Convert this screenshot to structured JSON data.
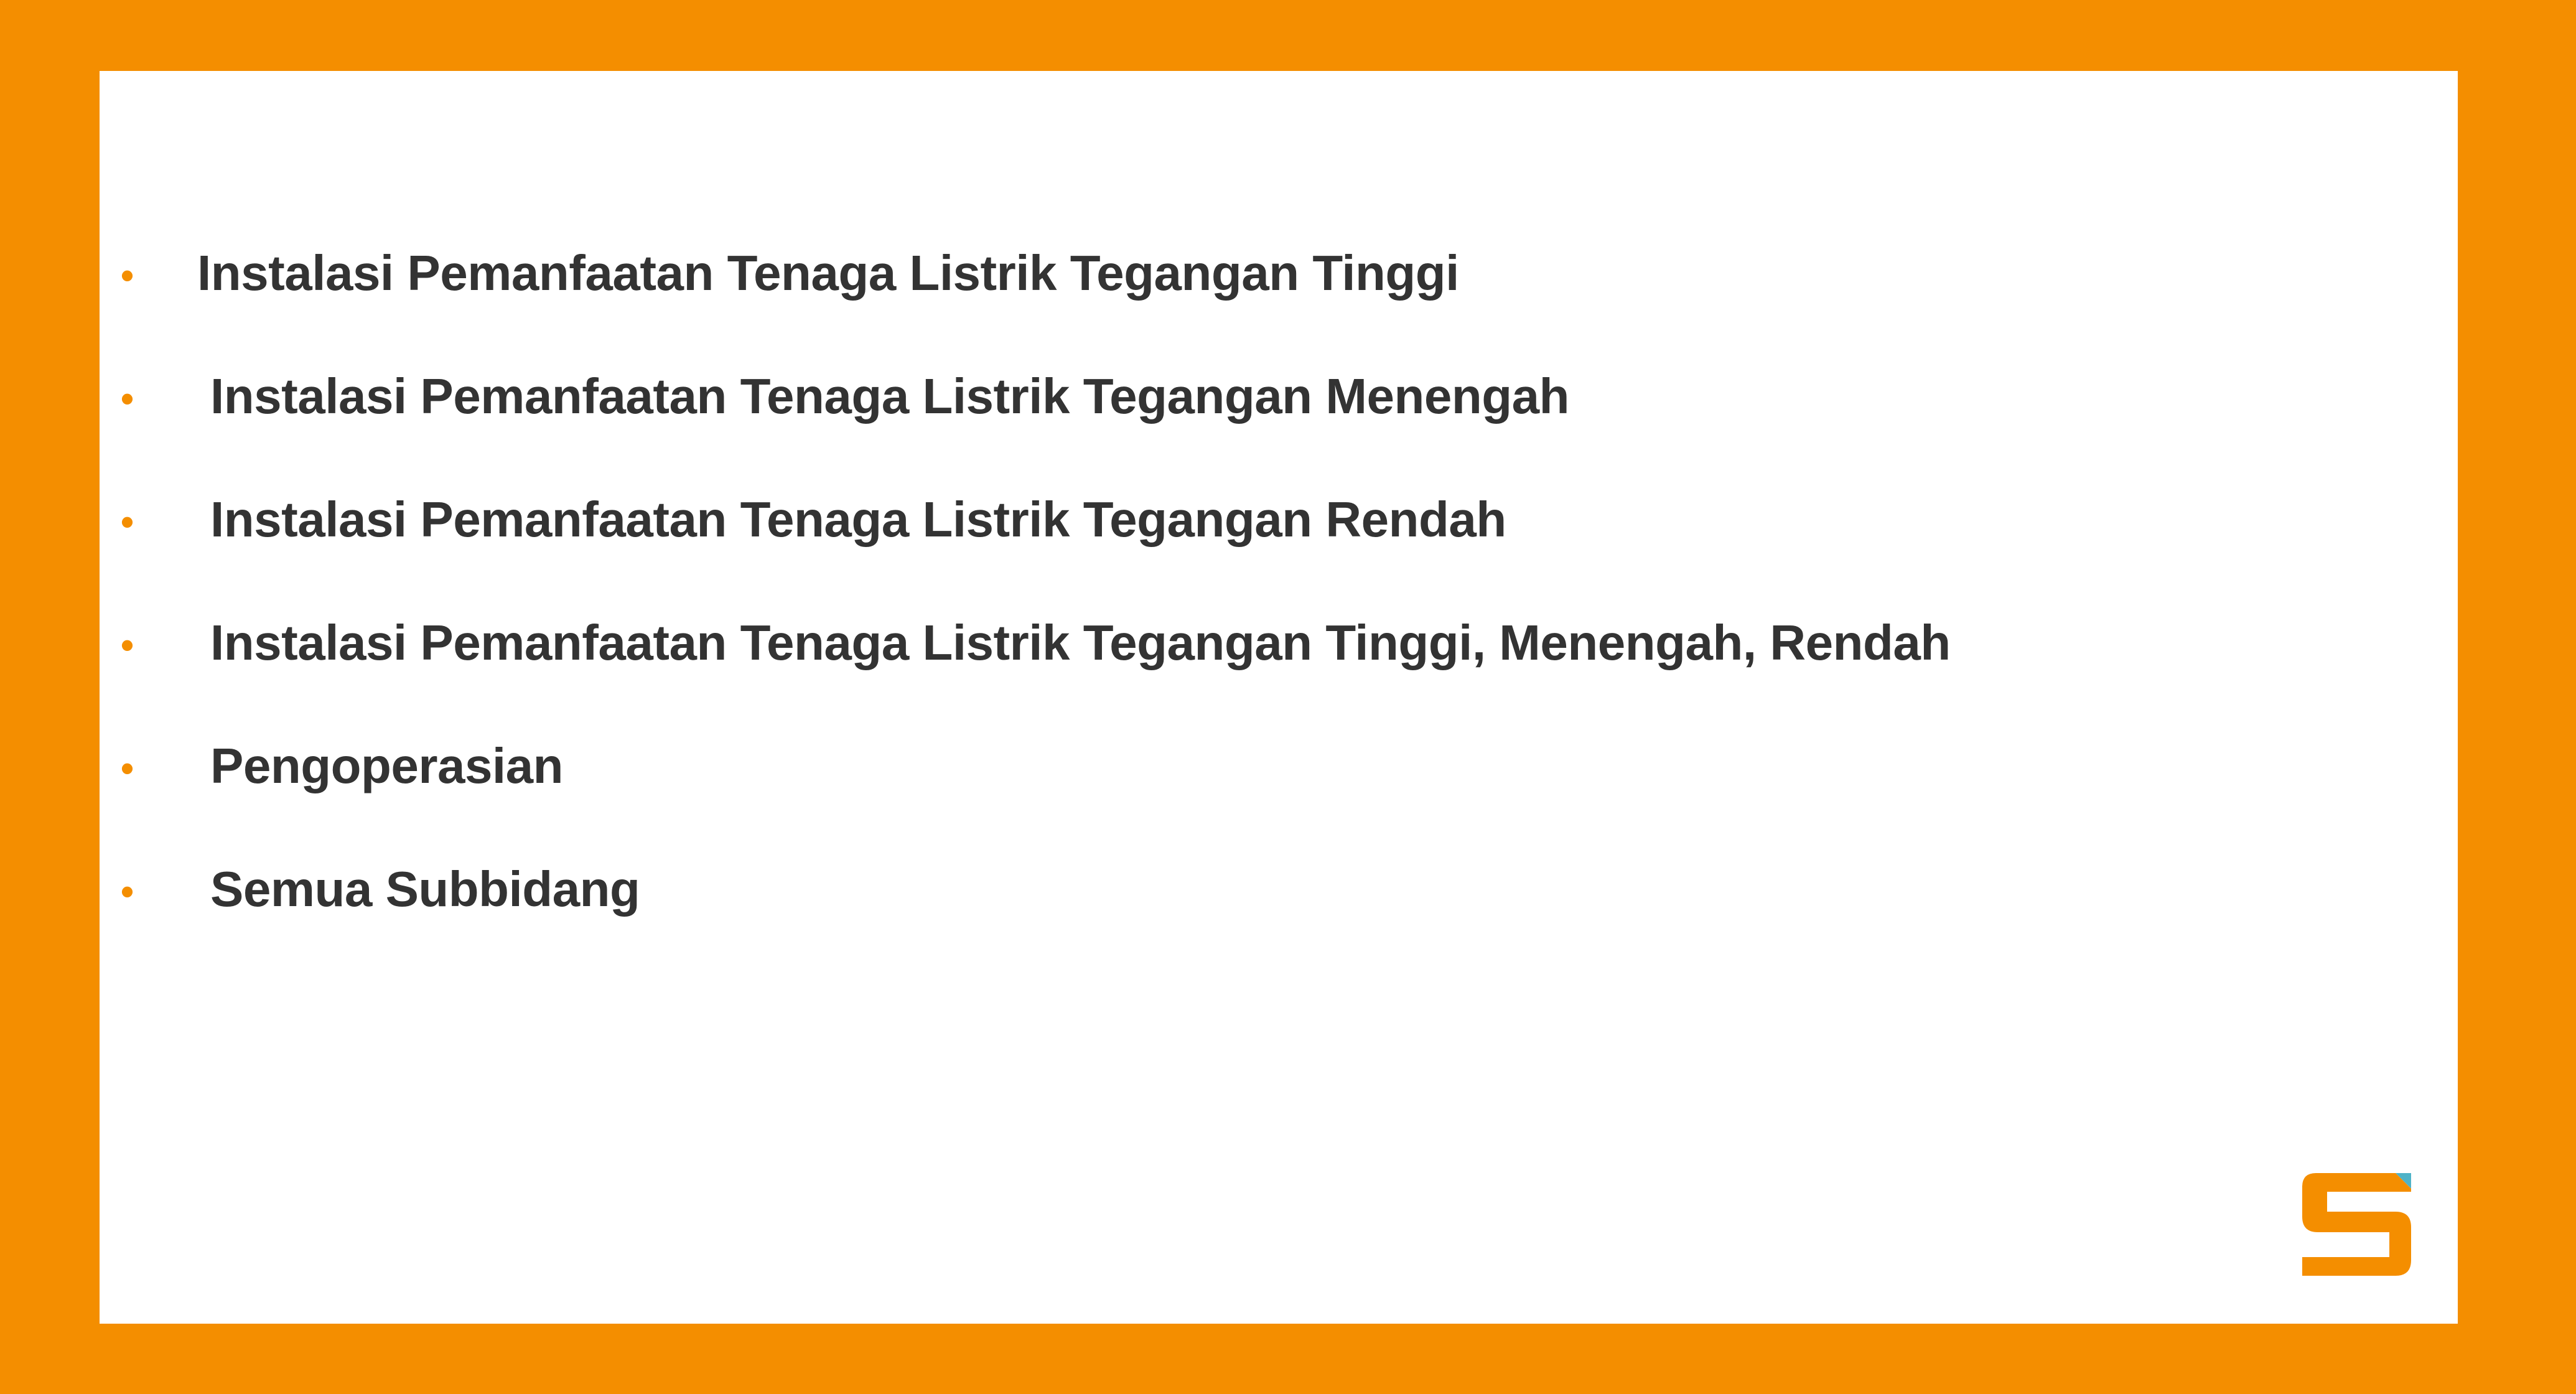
{
  "colors": {
    "frame": "#F48E00",
    "panel": "#FFFFFF",
    "text": "#333333",
    "bullet": "#F48E00",
    "logo_primary": "#F48E00",
    "logo_accent": "#4FB3C8"
  },
  "bullet_list": {
    "items": [
      {
        "label": "Instalasi Pemanfaatan Tenaga Listrik Tegangan Tinggi"
      },
      {
        "label": "Instalasi Pemanfaatan Tenaga Listrik Tegangan Menengah"
      },
      {
        "label": "Instalasi Pemanfaatan Tenaga Listrik Tegangan Rendah"
      },
      {
        "label": "Instalasi Pemanfaatan Tenaga Listrik Tegangan Tinggi, Menengah, Rendah"
      },
      {
        "label": "Pengoperasian"
      },
      {
        "label": "Semua Subbidang"
      }
    ],
    "bullet_symbol": "•"
  },
  "logo": {
    "icon": "s-logo-icon"
  }
}
